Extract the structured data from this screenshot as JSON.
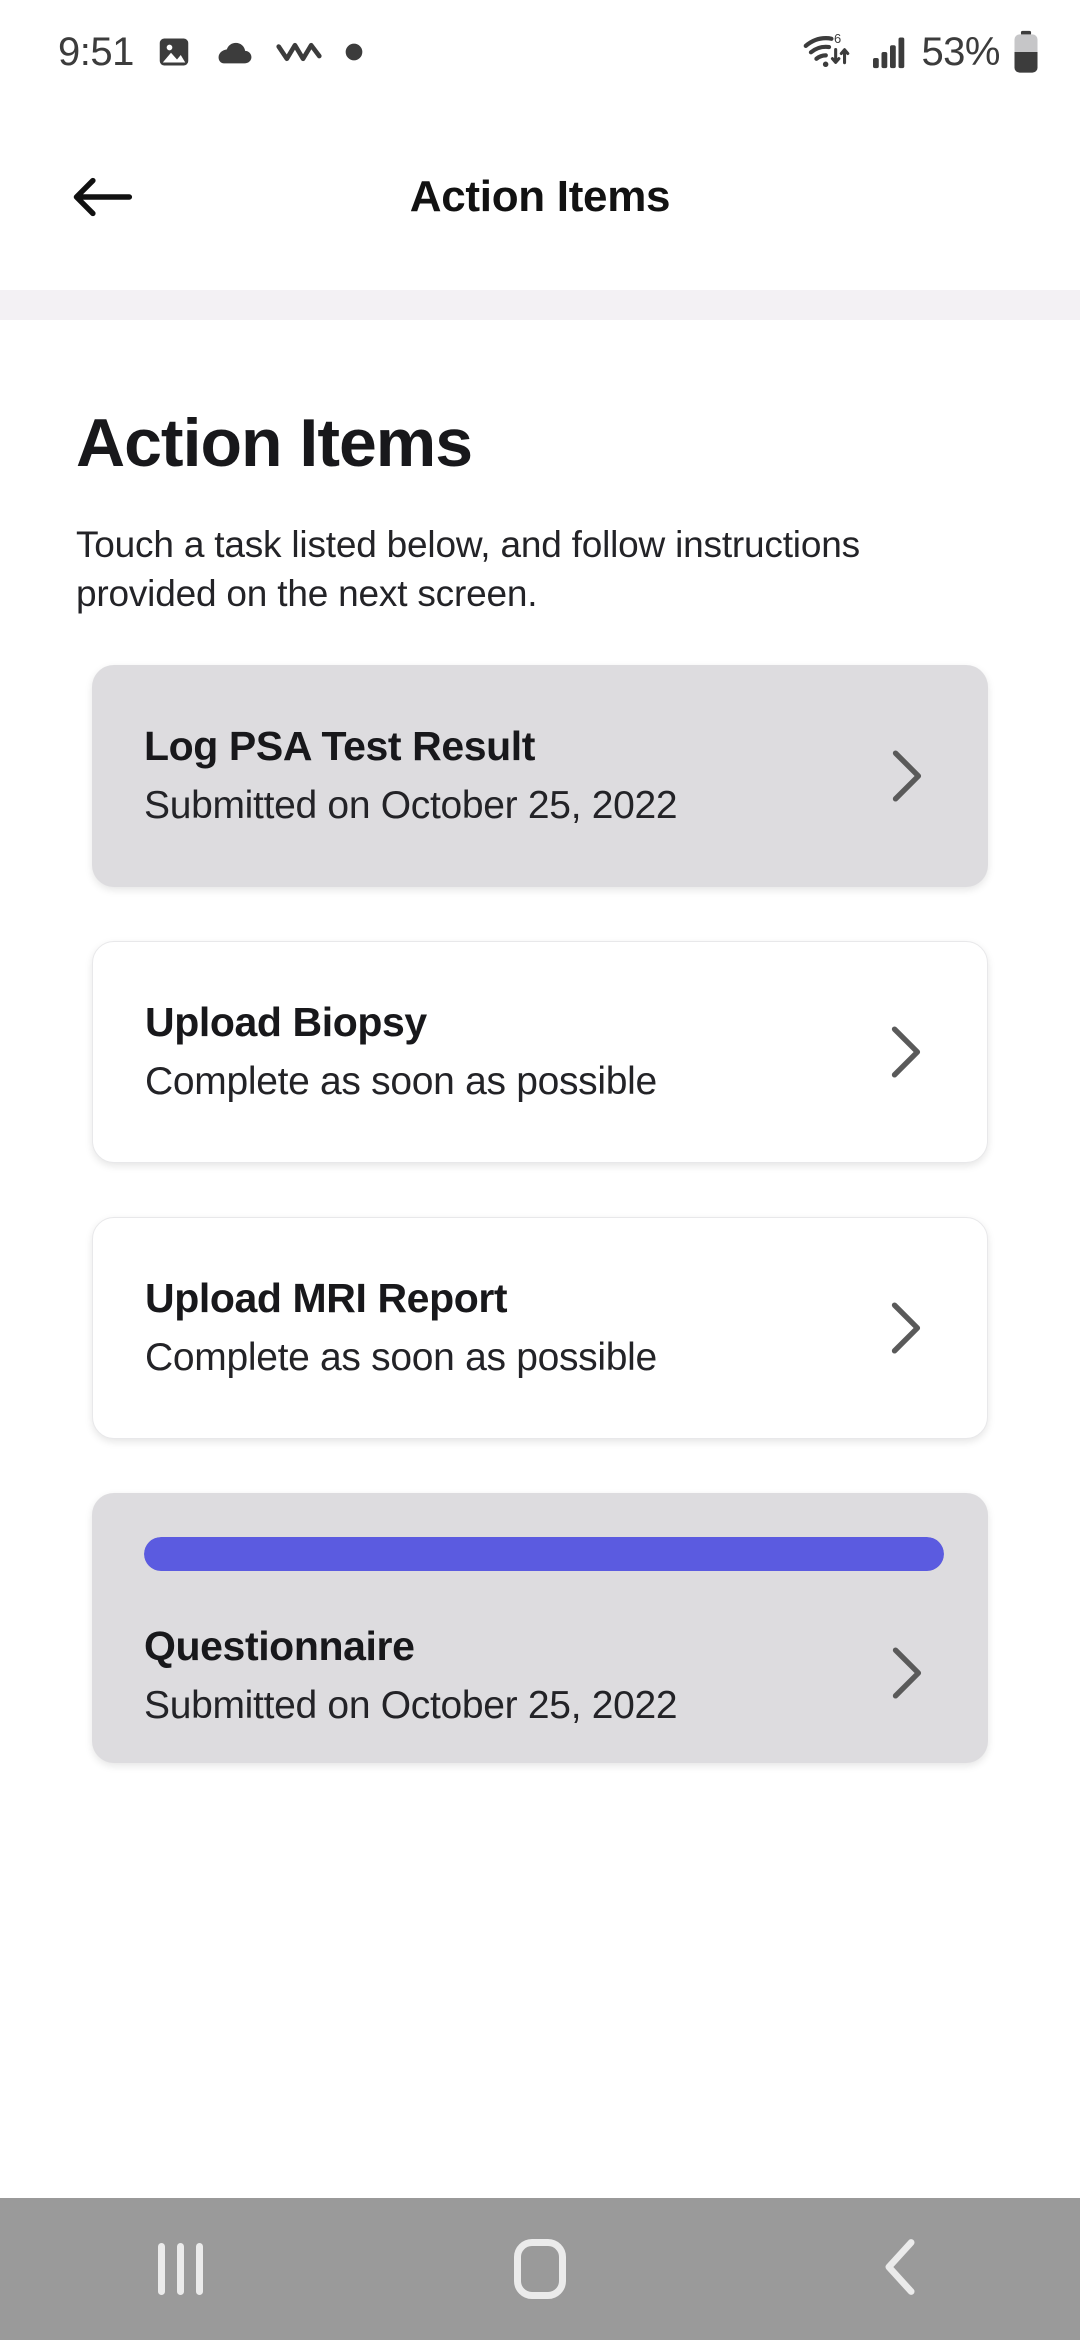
{
  "status_bar": {
    "time": "9:51",
    "battery_percent": "53%",
    "left_icons": [
      "photo-icon",
      "cloud-icon",
      "zigzag-activity-icon",
      "dot-icon"
    ],
    "right_icons": [
      "wifi-6-icon",
      "cellular-signal-icon",
      "battery-icon"
    ]
  },
  "app_bar": {
    "back_label": "back-arrow",
    "title": "Action Items"
  },
  "page": {
    "title": "Action Items",
    "subtitle": "Touch a task listed below, and follow instructions provided on the next screen."
  },
  "colors": {
    "progress_accent": "#5b5be0",
    "card_gray": "#dddcdf",
    "card_white": "#ffffff",
    "divider": "#f3f1f4",
    "nav_bar": "#9a9a9a",
    "chevron": "#5a5a5a"
  },
  "tasks": [
    {
      "title": "Log PSA Test Result",
      "status": "Submitted on October 25, 2022",
      "style": "gray",
      "has_progress": false
    },
    {
      "title": "Upload Biopsy",
      "status": "Complete as soon as possible",
      "style": "white",
      "has_progress": false
    },
    {
      "title": "Upload MRI Report",
      "status": "Complete as soon as possible",
      "style": "white",
      "has_progress": false
    },
    {
      "title": "Questionnaire",
      "status": "Submitted on October 25, 2022",
      "style": "gray",
      "has_progress": true,
      "progress_percent": 100
    }
  ],
  "nav_bar": {
    "recents_label": "recents-button",
    "home_label": "home-button",
    "back_label": "back-button"
  }
}
